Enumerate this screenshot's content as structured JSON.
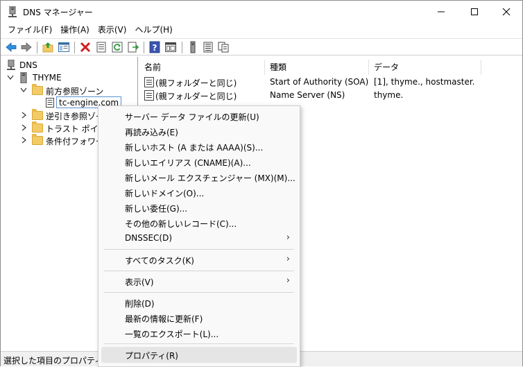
{
  "window": {
    "title": "DNS マネージャー",
    "controls": {
      "minimize": "—",
      "maximize": "☐",
      "close": "✕"
    }
  },
  "menubar": {
    "items": [
      "ファイル(F)",
      "操作(A)",
      "表示(V)",
      "ヘルプ(H)"
    ]
  },
  "toolbar": {
    "icons": [
      "back-arrow-icon",
      "forward-arrow-icon",
      "folder-up-icon",
      "show-hide-tree-icon",
      "delete-icon",
      "properties-icon",
      "refresh-icon",
      "export-icon",
      "help-icon",
      "console-icon",
      "server-icon",
      "list-icon",
      "copy-icon"
    ]
  },
  "tree": {
    "root": "DNS",
    "server": "THYME",
    "forward_zones": "前方参照ゾーン",
    "zone": "tc-engine.com",
    "reverse_zones": "逆引き参照ゾー",
    "trust_points": "トラスト ポイント",
    "conditional_forwarders": "条件付フォワーダ"
  },
  "list": {
    "columns": [
      "名前",
      "種類",
      "データ"
    ],
    "rows": [
      {
        "name": "(親フォルダーと同じ)",
        "type": "Start of Authority (SOA)",
        "data": "[1], thyme., hostmaster."
      },
      {
        "name": "(親フォルダーと同じ)",
        "type": "Name Server (NS)",
        "data": "thyme."
      }
    ]
  },
  "context_menu": {
    "items": [
      {
        "label": "サーバー データ ファイルの更新(U)"
      },
      {
        "label": "再読み込み(E)"
      },
      {
        "label": "新しいホスト (A または AAAA)(S)..."
      },
      {
        "label": "新しいエイリアス (CNAME)(A)..."
      },
      {
        "label": "新しいメール エクスチェンジャー (MX)(M)..."
      },
      {
        "label": "新しいドメイン(O)..."
      },
      {
        "label": "新しい委任(G)..."
      },
      {
        "label": "その他の新しいレコード(C)..."
      },
      {
        "label": "DNSSEC(D)",
        "submenu": true
      },
      {
        "label": "すべてのタスク(K)",
        "submenu": true
      },
      {
        "label": "表示(V)",
        "submenu": true
      },
      {
        "label": "削除(D)"
      },
      {
        "label": "最新の情報に更新(F)"
      },
      {
        "label": "一覧のエクスポート(L)..."
      },
      {
        "label": "プロパティ(R)",
        "highlighted": true
      }
    ],
    "submenu_arrow": "›"
  },
  "statusbar": {
    "text": "選択した項目のプロパティ ダイ"
  }
}
